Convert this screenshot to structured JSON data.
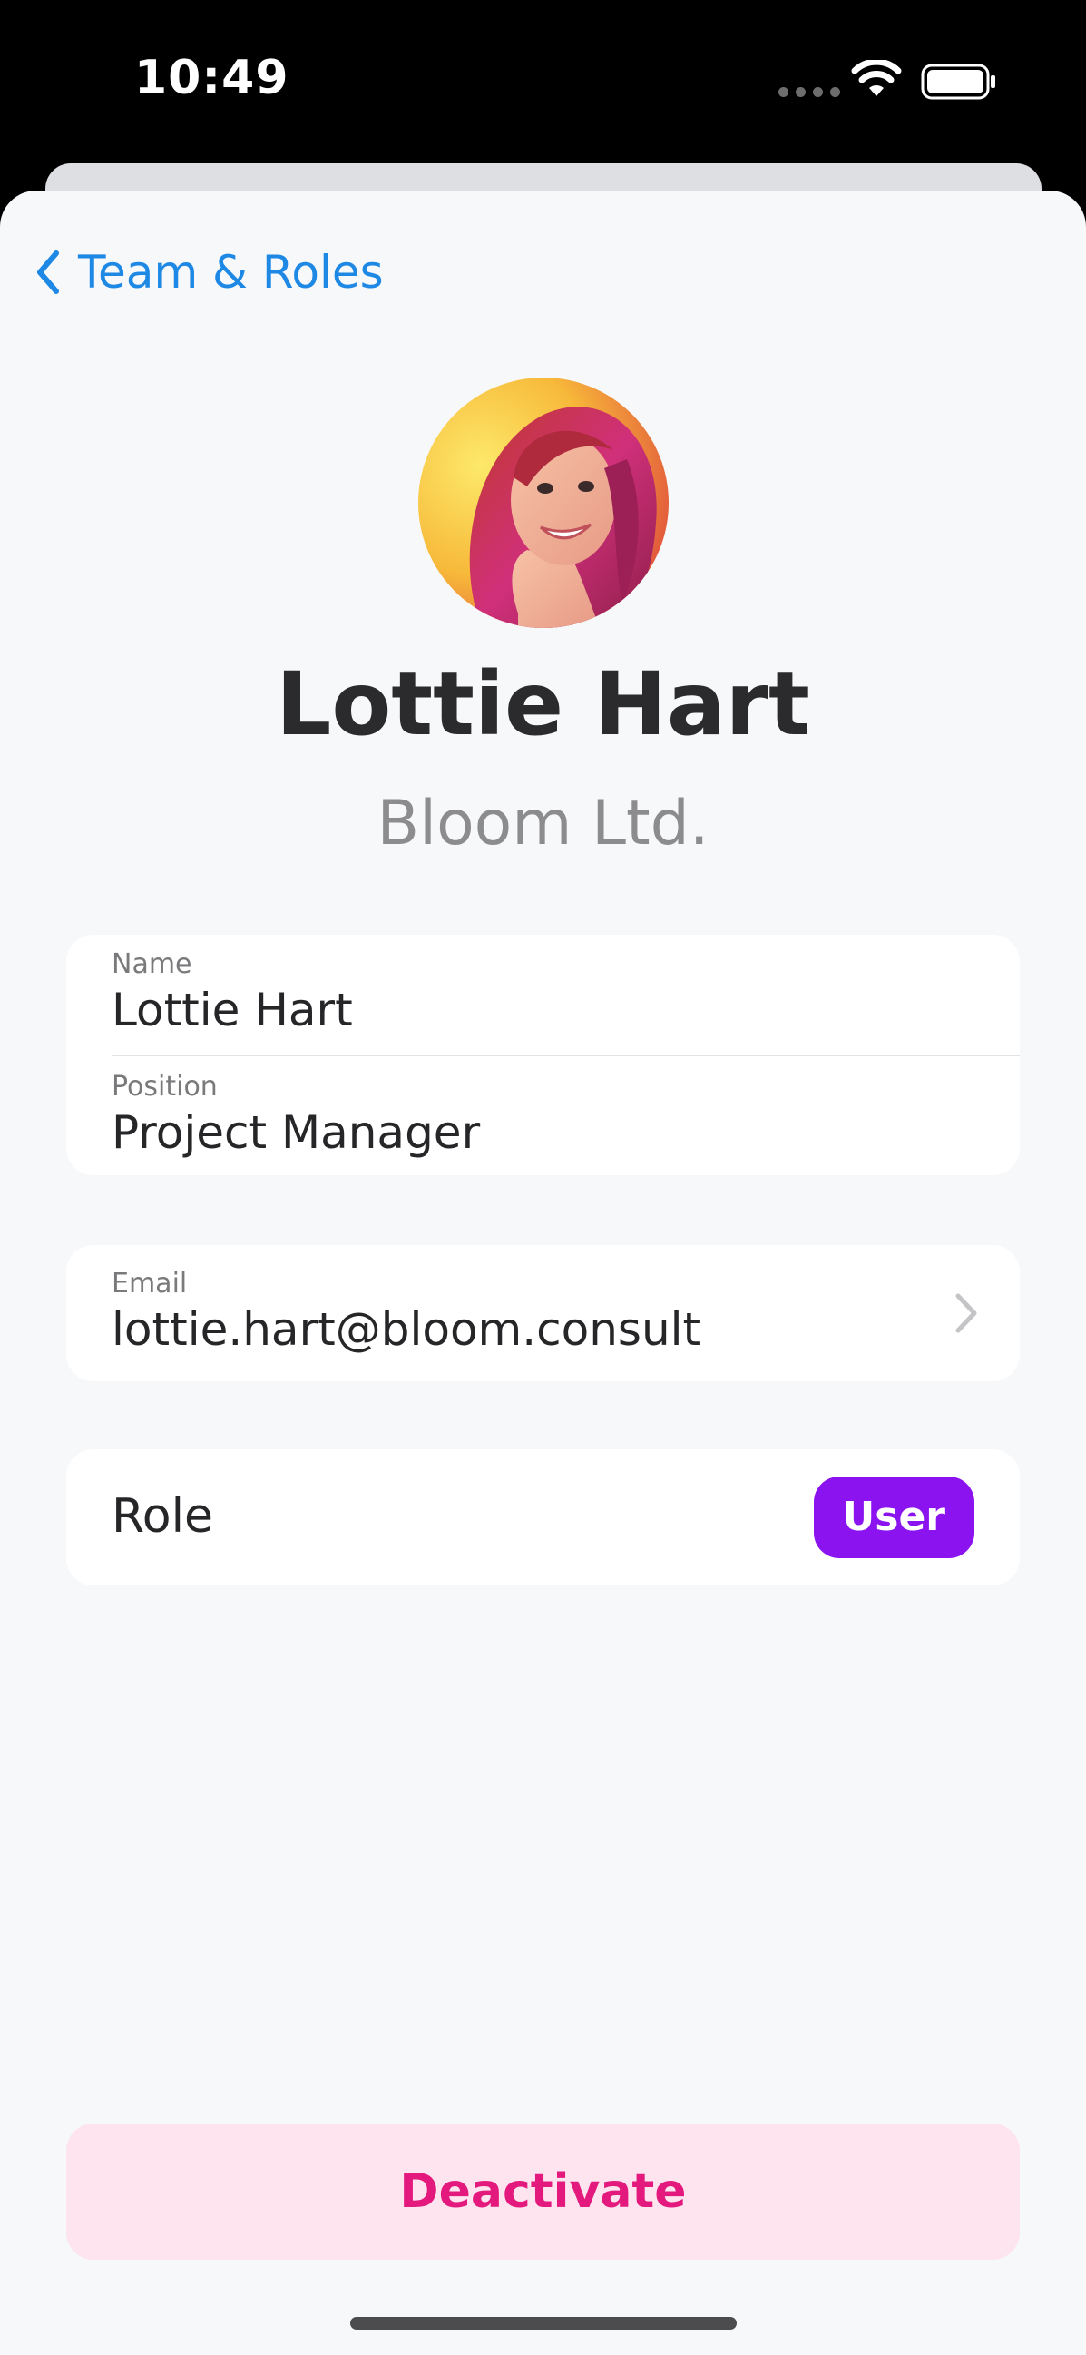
{
  "status_bar": {
    "time": "10:49",
    "icons": [
      "signal-dots-icon",
      "wifi-icon",
      "battery-icon"
    ]
  },
  "nav": {
    "back_label": "Team & Roles",
    "back_icon": "chevron-left-icon",
    "accent_color": "#1e88e5"
  },
  "profile": {
    "avatar": "avatar-photo",
    "name": "Lottie Hart",
    "company": "Bloom Ltd."
  },
  "info_card": {
    "name_label": "Name",
    "name_value": "Lottie Hart",
    "position_label": "Position",
    "position_value": "Project Manager"
  },
  "email_card": {
    "label": "Email",
    "value": "lottie.hart@bloom.consult",
    "icon": "chevron-right-icon"
  },
  "role_card": {
    "label": "Role",
    "badge": "User",
    "badge_color": "#8b13f0"
  },
  "actions": {
    "deactivate_label": "Deactivate",
    "deactivate_color": "#e3197d",
    "deactivate_bg": "#fde4ee"
  }
}
